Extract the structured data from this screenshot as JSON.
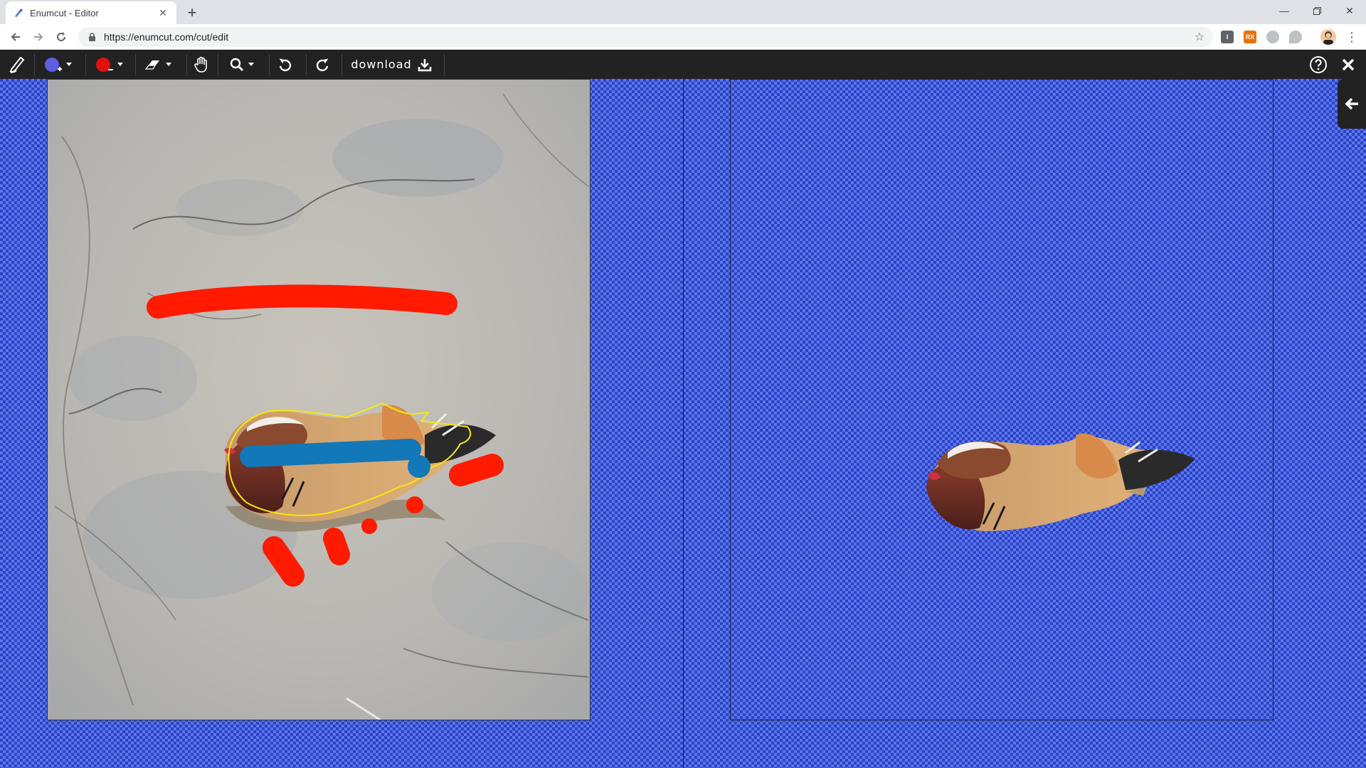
{
  "browser": {
    "tab_title": "Enumcut - Editor",
    "url": "https://enumcut.com/cut/edit",
    "extensions": [
      {
        "name": "ext-info-icon",
        "label": "I",
        "color": "#5f6368"
      },
      {
        "name": "ext-rx-icon",
        "label": "RX",
        "color": "#e8710a"
      },
      {
        "name": "ext-circle-icon",
        "label": "",
        "color": "#bdc1c6"
      },
      {
        "name": "ext-shield-icon",
        "label": "",
        "color": "#bdc1c6"
      }
    ]
  },
  "toolbar": {
    "download_label": "download",
    "foreground_color": "#5b5fe0",
    "background_color": "#e01010"
  },
  "colors": {
    "mark_foreground": "#1278b8",
    "mark_background": "#ff1a00",
    "selection_outline": "#f5e90a",
    "checker_dark": "#2b43c9",
    "checker_light": "#5b76e6"
  }
}
